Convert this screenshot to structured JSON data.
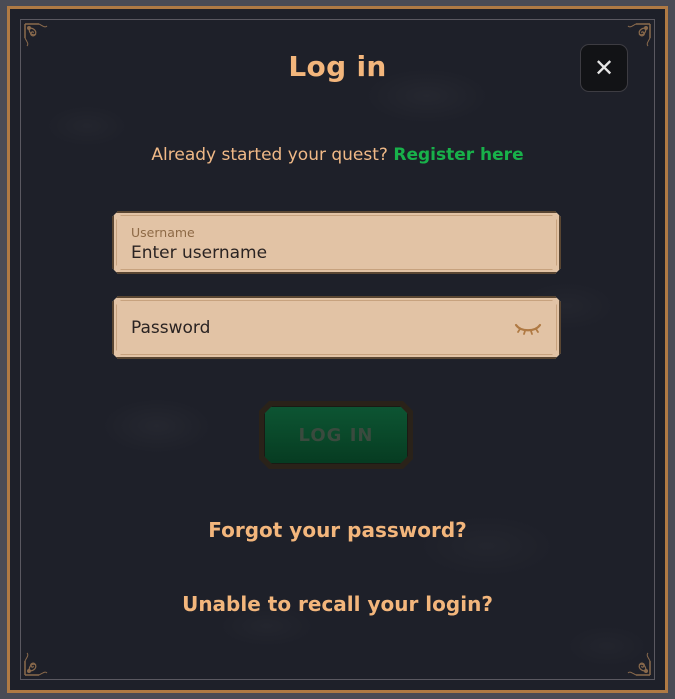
{
  "modal": {
    "title": "Log in",
    "close_icon": "close-icon",
    "close_glyph": "✕"
  },
  "register": {
    "prompt": "Already started your quest?",
    "link": "Register here"
  },
  "username": {
    "label": "Username",
    "placeholder": "Enter username"
  },
  "password": {
    "placeholder": "Password",
    "icon": "eye-closed-icon"
  },
  "login_button": {
    "label": "LOG IN"
  },
  "links": {
    "forgot": "Forgot your password?",
    "recall": "Unable to recall your login?"
  },
  "colors": {
    "background": "#1e2029",
    "accent": "#f3b67c",
    "register_link": "#18b14a",
    "field_bg": "#e2c3a5",
    "button_green": "#0a4a2b",
    "frame_bronze": "#b07a44"
  }
}
